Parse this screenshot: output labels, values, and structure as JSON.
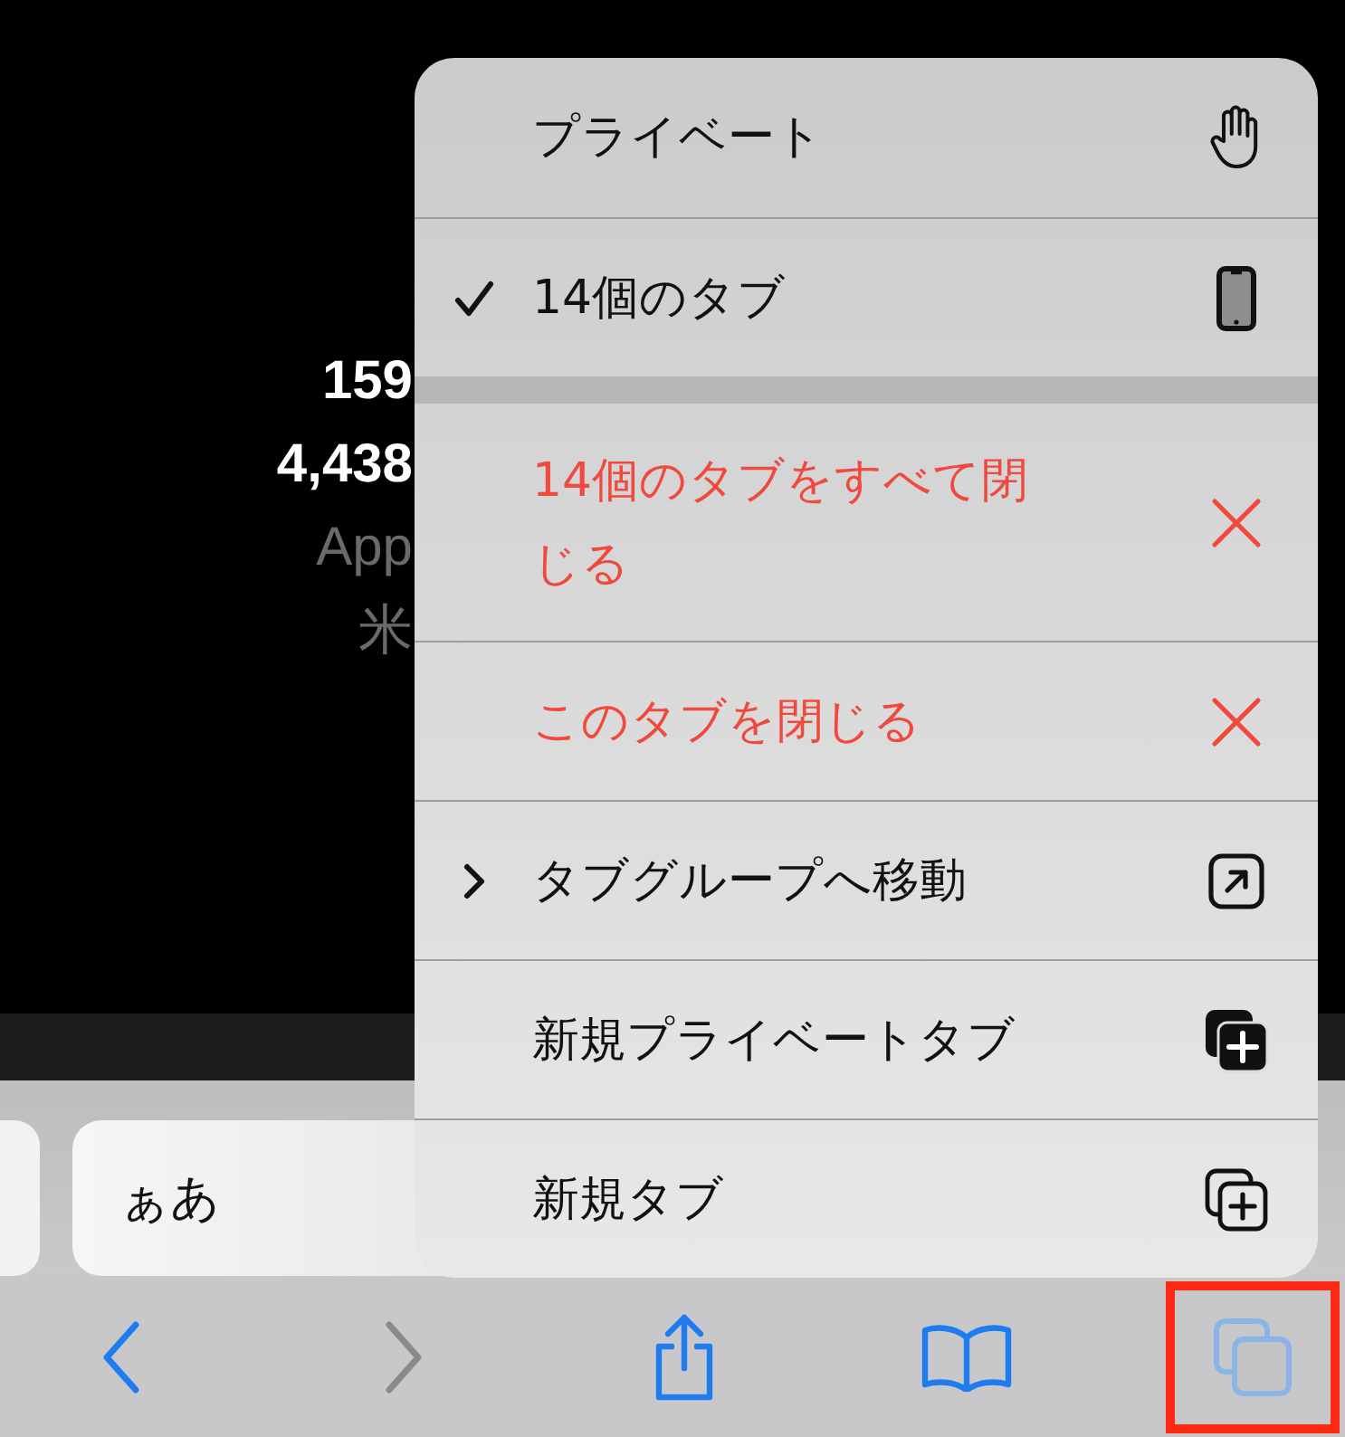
{
  "page_lines": [
    {
      "text": "159",
      "kind": "bold"
    },
    {
      "text": "4,438",
      "kind": "bold"
    },
    {
      "text": "App",
      "kind": "dim"
    },
    {
      "text": "米",
      "kind": "dim"
    }
  ],
  "address_bar": {
    "text": "ぁあ"
  },
  "menu": {
    "groups": [
      [
        {
          "label": "プライベート",
          "kind": "hand",
          "destructive": false,
          "checked": false,
          "submenu": false
        },
        {
          "label": "14個のタブ",
          "kind": "phone",
          "destructive": false,
          "checked": true,
          "submenu": false
        }
      ],
      [
        {
          "label": "14個のタブをすべて閉じる",
          "kind": "close",
          "destructive": true,
          "checked": false,
          "submenu": false
        },
        {
          "label": "このタブを閉じる",
          "kind": "close",
          "destructive": true,
          "checked": false,
          "submenu": false
        },
        {
          "label": "タブグループへ移動",
          "kind": "arrow-square",
          "destructive": false,
          "checked": false,
          "submenu": true
        },
        {
          "label": "新規プライベートタブ",
          "kind": "new-private",
          "destructive": false,
          "checked": false,
          "submenu": false
        },
        {
          "label": "新規タブ",
          "kind": "new-tab",
          "destructive": false,
          "checked": false,
          "submenu": false
        }
      ]
    ]
  },
  "toolbar": [
    {
      "kind": "back",
      "disabled": false,
      "highlighted": false
    },
    {
      "kind": "forward",
      "disabled": true,
      "highlighted": false
    },
    {
      "kind": "share",
      "disabled": false,
      "highlighted": false
    },
    {
      "kind": "bookmarks",
      "disabled": false,
      "highlighted": false
    },
    {
      "kind": "tabs",
      "disabled": false,
      "highlighted": true
    }
  ]
}
